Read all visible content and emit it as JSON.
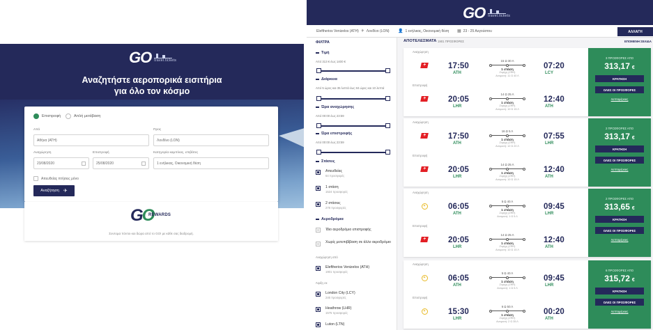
{
  "left": {
    "logo": {
      "go": "GO",
      "brand": "travel.tickets"
    },
    "hero_title": [
      "Αναζητήστε αεροπορικά εισιτήρια",
      "για όλο τον κόσμο"
    ],
    "trip": {
      "round": "Επιστροφή",
      "oneway": "Απλή μετάβαση"
    },
    "from_label": "Από",
    "from_value": "Αθήνα (ATH)",
    "to_label": "Προς",
    "to_value": "Λονδίνο (LON)",
    "depart_label": "Αναχώρηση",
    "depart_value": "23/08/2020",
    "return_label": "Επιστροφή",
    "return_value": "25/08/2020",
    "cabin_label": "Κατηγορία καμπίνας, επιβάτες",
    "cabin_value": "1 ενήλικας, Οικονομική θέση",
    "direct_only": "Απευθείας πτήσεις μόνο",
    "search_btn": "Αναζήτηση",
    "rewards": {
      "brand": "REWARDS",
      "text": "Συντομα πόντοι και δώρα από το GO! με κάθε σας διαδρομή."
    }
  },
  "right": {
    "logo": {
      "go": "GO",
      "brand": "travel.tickets"
    },
    "searchbar": {
      "from": "Eleftherios Venizelos (ATH)",
      "to": "Λονδίνο (LON)",
      "pax": "1 ενήλικας, Οικονομική θέση",
      "dates": "23 - 25 Αυγούστου",
      "change": "ΑΛΛΑΓΗ"
    },
    "filters": {
      "title": "ΦΙΛΤΡΑ",
      "price": {
        "head": "Τιμή",
        "sub": "Από 313 € έως 1400 €"
      },
      "duration": {
        "head": "Διάρκεια",
        "sub": "Από 5 ώρες και 35 λεπτά έως 84 ώρες και 10 λεπτά"
      },
      "dep_time": {
        "head": "Ώρα αναχώρησης",
        "sub": "Από 00:00 έως 23:59"
      },
      "ret_time": {
        "head": "Ώρα επιστροφής",
        "sub": "Από 00:00 έως 23:59"
      },
      "stops": {
        "head": "Στάσεις",
        "opts": [
          {
            "label": "Απευθείας",
            "count": "64 προσφορές"
          },
          {
            "label": "1 στάση",
            "count": "1524 προσφορές"
          },
          {
            "label": "2 στάσεις",
            "count": "278 προσφορές"
          }
        ]
      },
      "airports": {
        "head": "Αεροδρόμια",
        "same": "Ίδιο αεροδρόμιο επιστροφής",
        "nochange": "Χωρίς μετεπιβίβαση σε άλλο αεροδρόμιο",
        "dep_label": "Αναχώρηση από",
        "dep": {
          "label": "Eleftherios Venizelos (ATH)",
          "count": "1901 προσφορές"
        },
        "arr_label": "Άφιξη σε",
        "arr": [
          {
            "label": "London City (LCY)",
            "count": "246 προσφορές"
          },
          {
            "label": "Heathrow (LHR)",
            "count": "1575 προσφορές"
          },
          {
            "label": "Luton (LTN)",
            "count": ""
          }
        ]
      }
    },
    "results": {
      "title": "ΑΠΟΤΕΛΕΣΜΑΤΑ",
      "count": "1901 ΠΡΟΣΦΟΡΕΣ",
      "next": "ΕΠΟΜΕΝΗ ΣΕΛΙΔΑ"
    },
    "cards": [
      {
        "out": {
          "label": "Αναχώρηση",
          "air": "swiss",
          "dep": "17:50",
          "from": "ATH",
          "dur": "15 Ω 30 Λ",
          "stops": "1 στάση",
          "via": [
            "Ζυρίχη (ZRH)",
            "Αναμονή: 11 Ω 40 Λ"
          ],
          "arr": "07:20",
          "to": "LCY"
        },
        "ret": {
          "label": "Επιστροφή",
          "air": "swiss",
          "dep": "20:05",
          "from": "LHR",
          "dur": "14 Ω 25 Λ",
          "stops": "1 στάση",
          "via": [
            "Ζυρίχη (ZRH)",
            "Αναμονή: 10 Ω 15 Λ"
          ],
          "arr": "12:40",
          "to": "ATH"
        },
        "price": {
          "offers": "3 ΠΡΟΣΦΟΡΕΣ ΑΠΟ",
          "value": "313,17",
          "cur": "€",
          "book": "ΚΡΑΤΗΣΗ",
          "all": "ΟΛΕΣ ΟΙ ΠΡΟΣΦΟΡΕΣ",
          "details": "Λεπτομέρειες"
        }
      },
      {
        "out": {
          "label": "Αναχώρηση",
          "air": "swiss",
          "dep": "17:50",
          "from": "ATH",
          "dur": "16 Ω 5 Λ",
          "stops": "1 στάση",
          "via": [
            "Ζυρίχη (ZRH)",
            "Αναμονή: 12 Ω 20 Λ"
          ],
          "arr": "07:55",
          "to": "LHR"
        },
        "ret": {
          "label": "Επιστροφή",
          "air": "swiss",
          "dep": "20:05",
          "from": "LHR",
          "dur": "14 Ω 25 Λ",
          "stops": "1 στάση",
          "via": [
            "Ζυρίχη (ZRH)",
            "Αναμονή: 10 Ω 15 Λ"
          ],
          "arr": "12:40",
          "to": "ATH"
        },
        "price": {
          "offers": "2 ΠΡΟΣΦΟΡΕΣ ΑΠΟ",
          "value": "313,17",
          "cur": "€",
          "book": "ΚΡΑΤΗΣΗ",
          "all": "ΟΛΕΣ ΟΙ ΠΡΟΣΦΟΡΕΣ",
          "details": "Λεπτομέρειες"
        }
      },
      {
        "out": {
          "label": "Αναχώρηση",
          "air": "aegean",
          "dep": "06:05",
          "from": "ATH",
          "dur": "5 Ω 40 Λ",
          "stops": "1 στάση",
          "via": [
            "Ζυρίχη (ZRH)",
            "Αναμονή: 1 Ω 5 Λ"
          ],
          "arr": "09:45",
          "to": "LHR"
        },
        "ret": {
          "label": "Επιστροφή",
          "air": "swiss",
          "dep": "20:05",
          "from": "LHR",
          "dur": "14 Ω 25 Λ",
          "stops": "1 στάση",
          "via": [
            "Ζυρίχη (ZRH)",
            "Αναμονή: 10 Ω 15 Λ"
          ],
          "arr": "12:40",
          "to": "ATH"
        },
        "price": {
          "offers": "2 ΠΡΟΣΦΟΡΕΣ ΑΠΟ",
          "value": "313,65",
          "cur": "€",
          "book": "ΚΡΑΤΗΣΗ",
          "all": "ΟΛΕΣ ΟΙ ΠΡΟΣΦΟΡΕΣ",
          "details": "Λεπτομέρειες"
        }
      },
      {
        "out": {
          "label": "Αναχώρηση",
          "air": "aegean",
          "dep": "06:05",
          "from": "ATH",
          "dur": "5 Ω 40 Λ",
          "stops": "1 στάση",
          "via": [
            "Ζυρίχη (ZRH)",
            "Αναμονή: 1 Ω 5 Λ"
          ],
          "arr": "09:45",
          "to": "LHR"
        },
        "ret": {
          "label": "Επιστροφή",
          "air": "aegean",
          "dep": "15:30",
          "from": "LHR",
          "dur": "6 Ω 50 Λ",
          "stops": "1 στάση",
          "via": [
            "Ζυρίχη (ZRH)",
            "Αναμονή: 2 Ω 35 Λ"
          ],
          "arr": "00:20",
          "to": "ATH"
        },
        "price": {
          "offers": "6 ΠΡΟΣΦΟΡΕΣ ΑΠΟ",
          "value": "315,72",
          "cur": "€",
          "book": "ΚΡΑΤΗΣΗ",
          "all": "ΟΛΕΣ ΟΙ ΠΡΟΣΦΟΡΕΣ",
          "details": "Λεπτομέρειες"
        }
      }
    ]
  }
}
